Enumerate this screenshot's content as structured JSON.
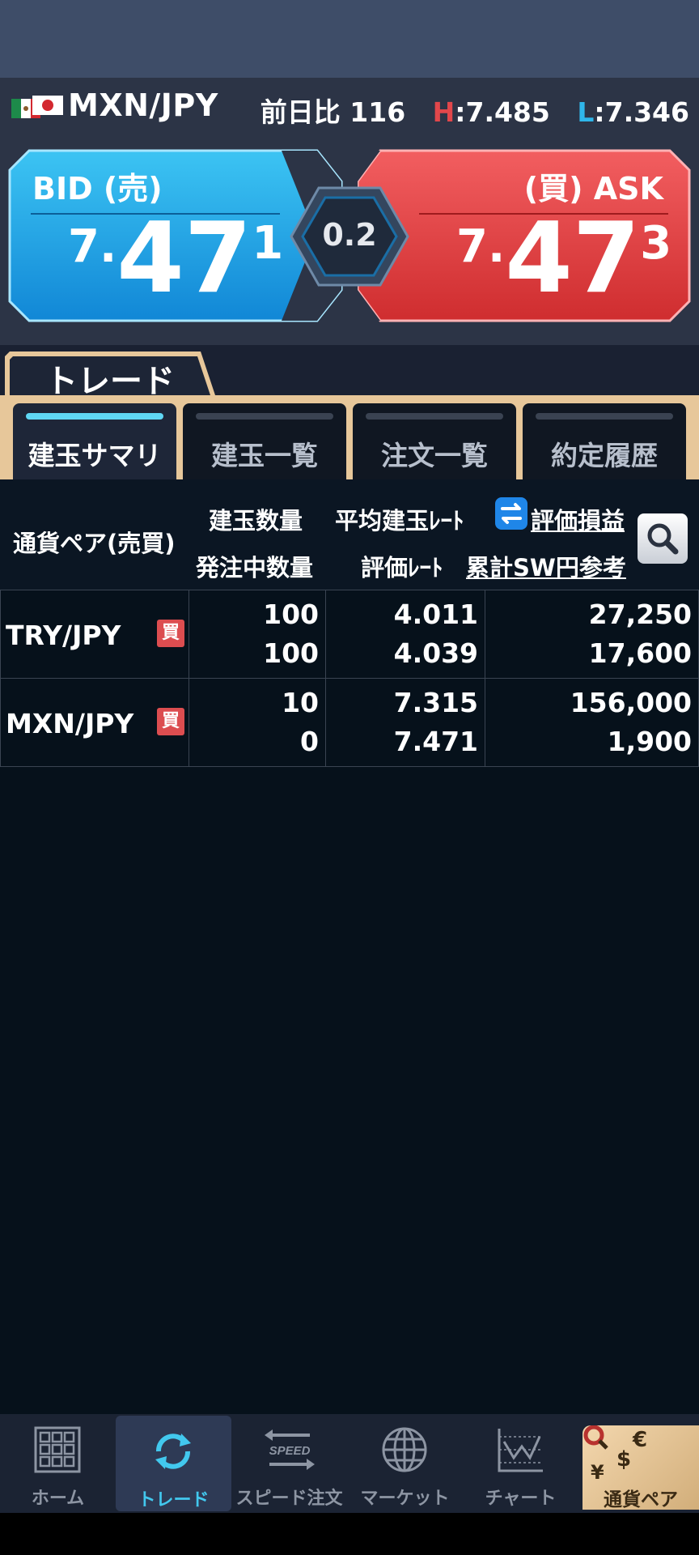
{
  "header": {
    "pair": "MXN/JPY",
    "day_change_label": "前日比",
    "day_change_value": "116",
    "high_letter": "H",
    "high_value": ":7.485",
    "low_letter": "L",
    "low_value": ":7.346"
  },
  "quote": {
    "bid_label": "BID (売)",
    "bid_small": "7.",
    "bid_big": "47",
    "bid_pip": "1",
    "ask_label": "(買) ASK",
    "ask_small": "7.",
    "ask_big": "47",
    "ask_pip": "3",
    "spread": "0.2"
  },
  "section_tab": "トレード",
  "subtabs": [
    "建玉サマリ",
    "建玉一覧",
    "注文一覧",
    "約定履歴"
  ],
  "columns": {
    "pair_side": "通貨ペア(売買)",
    "position_qty": "建玉数量",
    "pending_qty": "発注中数量",
    "avg_rate": "平均建玉ﾚｰﾄ",
    "valuation_rate": "評価ﾚｰﾄ",
    "valuation_pl": "評価損益",
    "swap_total": "累計SW円参考"
  },
  "rows": [
    {
      "pair": "TRY/JPY",
      "side": "買",
      "position_qty": "100",
      "pending_qty": "100",
      "avg_rate": "4.011",
      "valuation_rate": "4.039",
      "valuation_pl": "27,250",
      "swap_total": "17,600"
    },
    {
      "pair": "MXN/JPY",
      "side": "買",
      "position_qty": "10",
      "pending_qty": "0",
      "avg_rate": "7.315",
      "valuation_rate": "7.471",
      "valuation_pl": "156,000",
      "swap_total": "1,900"
    }
  ],
  "nav": {
    "home": "ホーム",
    "trade": "トレード",
    "speed_order": "スピード注文",
    "speed_icon_text": "SPEED",
    "market": "マーケット",
    "chart": "チャート",
    "currency_pair": "通貨ペア"
  },
  "icons": [
    "mexico-flag-icon",
    "japan-flag-icon",
    "swap-icon",
    "search-icon",
    "grid-icon",
    "refresh-icon",
    "speed-icon",
    "globe-icon",
    "chart-icon",
    "currency-icon"
  ],
  "colors": {
    "bid": "#1e9fe6",
    "ask": "#dc3c3d",
    "high": "#e2474b",
    "low": "#2fb6ea",
    "buy_badge": "#dc4d50",
    "active_tab_accent": "#5fd7f4"
  }
}
